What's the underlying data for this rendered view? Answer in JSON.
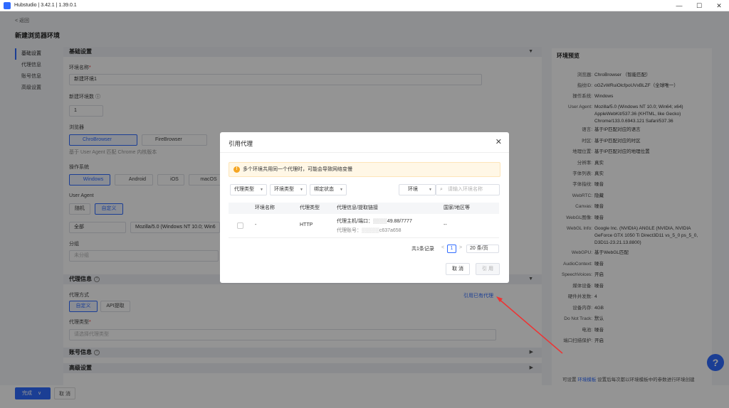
{
  "window": {
    "title": "Hubstudio | 3.42.1 | 1.39.0.1",
    "minimize": "—",
    "maximize": "☐",
    "close": "✕"
  },
  "header": {
    "back": "< 返回",
    "page_title": "新建浏览器环境"
  },
  "leftnav": [
    "基础设置",
    "代理信息",
    "账号信息",
    "高级设置"
  ],
  "basic": {
    "section_title": "基础设置",
    "env_name_label": "环境名称",
    "env_name_value": "新建环境1",
    "env_count_label": "新建环境数",
    "env_count_value": "1",
    "browser_label": "浏览器",
    "browser_options": [
      "ChroBrowser",
      "FireBrowser"
    ],
    "browser_hint": "基于 User Agent 匹配 Chrome 内核版本",
    "os_label": "操作系统",
    "os_options": [
      "Windows",
      "Android",
      "iOS",
      "macOS"
    ],
    "ua_label": "User Agent",
    "ua_modes": [
      "随机",
      "自定义"
    ],
    "ua_filter": "全部",
    "ua_value": "Mozilla/5.0 (Windows NT 10.0; Win6",
    "group_label": "分组",
    "group_value": "未分组"
  },
  "proxy": {
    "section_title": "代理信息",
    "mode_label": "代理方式",
    "modes": [
      "自定义",
      "API提取"
    ],
    "type_label": "代理类型",
    "type_placeholder": "请选择代理类型",
    "quote_link": "引用已有代理"
  },
  "account": {
    "section_title": "账号信息"
  },
  "advanced": {
    "section_title": "高级设置"
  },
  "preview": {
    "title": "环境预览",
    "rows": [
      {
        "k": "浏览器:",
        "v": "ChroBrowser （智能匹配）"
      },
      {
        "k": "指纹ID:",
        "v": "oGZvWRuiOlcfpoUVxBLZF（全球唯一）"
      },
      {
        "k": "操作系统:",
        "v": "Windows"
      },
      {
        "k": "User Agent:",
        "v": "Mozilla/5.0 (Windows NT 10.0; Win64; x64) AppleWebKit/537.36 (KHTML, like Gecko) Chrome/133.0.6943.121 Safari/537.36"
      },
      {
        "k": "语言:",
        "v": "基于IP匹配对应的语言"
      },
      {
        "k": "时区:",
        "v": "基于IP匹配对应的时区"
      },
      {
        "k": "地理位置:",
        "v": "基于IP匹配对应的地理位置"
      },
      {
        "k": "分辨率:",
        "v": "真实"
      },
      {
        "k": "字体列表:",
        "v": "真实"
      },
      {
        "k": "字体指纹:",
        "v": "噪音"
      },
      {
        "k": "WebRTC:",
        "v": "隐藏"
      },
      {
        "k": "Canvas:",
        "v": "噪音"
      },
      {
        "k": "WebGL图像:",
        "v": "噪音"
      },
      {
        "k": "WebGL Info:",
        "v": "Google Inc. (NVIDIA) ANGLE (NVIDIA, NVIDIA GeForce GTX 1050 Ti Direct3D11 vs_5_0 ps_5_0, D3D11-23.21.13.8800)"
      },
      {
        "k": "WebGPU:",
        "v": "基于WebGL匹配"
      },
      {
        "k": "AudioContext:",
        "v": "噪音"
      },
      {
        "k": "SpeechVoices:",
        "v": "开启"
      },
      {
        "k": "媒体设备:",
        "v": "噪音"
      },
      {
        "k": "硬件并发数:",
        "v": "4"
      },
      {
        "k": "设备内存:",
        "v": "4GB"
      },
      {
        "k": "Do Not Track:",
        "v": "默认"
      },
      {
        "k": "电池:",
        "v": "噪音"
      },
      {
        "k": "端口扫描保护:",
        "v": "开启"
      }
    ],
    "footer_pre": "可设置",
    "footer_link": "环境模板",
    "footer_post": "设置后每次都以环境模板中的参数进行环境创建"
  },
  "bottom": {
    "finish": "完成",
    "cancel": "取 消"
  },
  "help": "?",
  "modal": {
    "title": "引用代理",
    "close": "✕",
    "warning": "多个环境共用同一个代理时，可能会导致网络变慢",
    "filters": [
      "代理类型",
      "环境类型",
      "绑定状态"
    ],
    "env_select": "环境",
    "search_placeholder": "请输入环境名称",
    "columns": [
      "环境名称",
      "代理类型",
      "代理信息/提取链接",
      "国家/地区等"
    ],
    "row": {
      "env_name": "-",
      "proxy_type": "HTTP",
      "host": "代理主机/端口：",
      "host_value": "49.88/7777",
      "account": "代理账号：",
      "account_value": "c637a658",
      "country": "--"
    },
    "total": "共1条记录",
    "page": "1",
    "page_size": "20 条/页",
    "cancel": "取 消",
    "confirm": "引 用"
  }
}
